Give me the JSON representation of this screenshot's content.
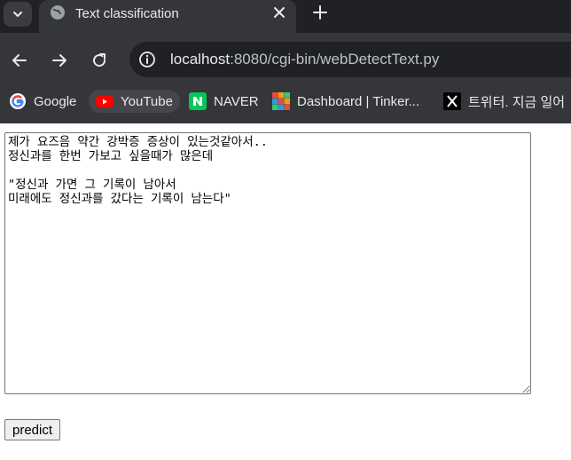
{
  "tab": {
    "title": "Text classification",
    "icon": "globe-icon"
  },
  "address_bar": {
    "url_host": "localhost",
    "url_rest": ":8080/cgi-bin/webDetectText.py"
  },
  "bookmarks": [
    {
      "label": "Google",
      "icon": "google-icon"
    },
    {
      "label": "YouTube",
      "icon": "youtube-icon"
    },
    {
      "label": "NAVER",
      "icon": "naver-icon"
    },
    {
      "label": "Dashboard | Tinker...",
      "icon": "tinkercad-icon"
    },
    {
      "label": "트위터. 지금 일어",
      "icon": "x-icon"
    }
  ],
  "form": {
    "text_value": "제가 요즈음 약간 강박증 증상이 있는것같아서..\n정신과를 한번 가보고 싶을때가 많은데\n\n\"정신과 가면 그 기록이 남아서\n미래에도 정신과를 갔다는 기록이 남는다\"",
    "submit_label": "predict"
  },
  "colors": {
    "tabstrip": "#202124",
    "toolbar": "#35363a",
    "omnibox": "#202124",
    "text_light": "#e8eaed"
  }
}
